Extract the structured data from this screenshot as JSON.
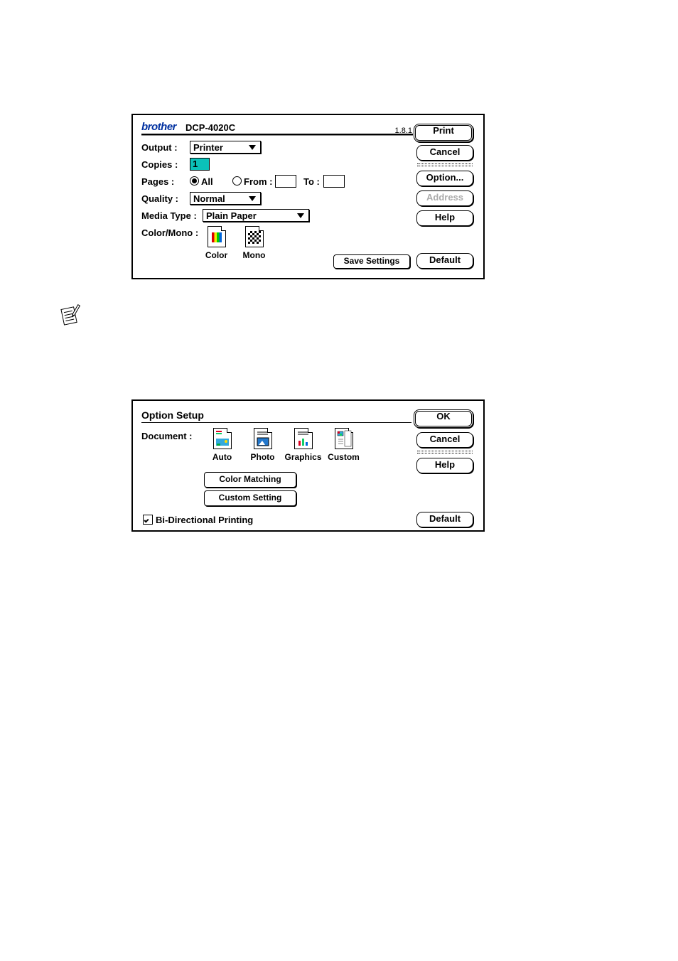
{
  "dialog1": {
    "brand": "brother",
    "model": "DCP-4020C",
    "version": "1.8.1",
    "labels": {
      "output": "Output :",
      "copies": "Copies :",
      "pages": "Pages :",
      "quality": "Quality :",
      "media": "Media Type :",
      "colormono": "Color/Mono :"
    },
    "output_value": "Printer",
    "copies_value": "1",
    "pages_all": "All",
    "pages_from": "From :",
    "pages_to": "To :",
    "quality_value": "Normal",
    "media_value": "Plain Paper",
    "color_caption": "Color",
    "mono_caption": "Mono",
    "buttons": {
      "print": "Print",
      "cancel": "Cancel",
      "option": "Option...",
      "address": "Address",
      "help": "Help",
      "save": "Save Settings",
      "default": "Default"
    }
  },
  "dialog2": {
    "title": "Option Setup",
    "document_label": "Document :",
    "doc_auto": "Auto",
    "doc_photo": "Photo",
    "doc_graphics": "Graphics",
    "doc_custom": "Custom",
    "color_matching": "Color Matching",
    "custom_setting": "Custom Setting",
    "bidir": "Bi-Directional Printing",
    "buttons": {
      "ok": "OK",
      "cancel": "Cancel",
      "help": "Help",
      "default": "Default"
    }
  }
}
